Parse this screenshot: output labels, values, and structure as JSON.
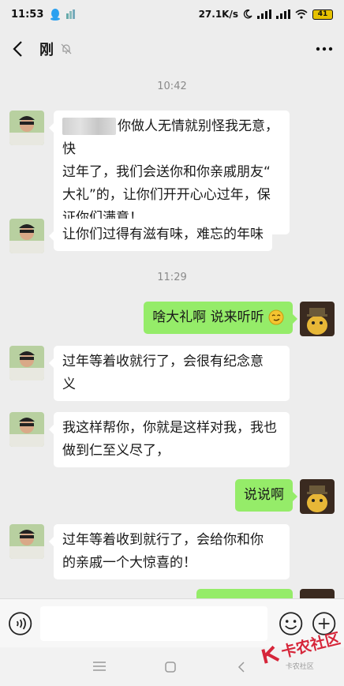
{
  "status_bar": {
    "time": "11:53",
    "net_speed": "27.1K/s",
    "battery": "41"
  },
  "header": {
    "title": "刚"
  },
  "timestamps": [
    "10:42",
    "11:29"
  ],
  "messages": [
    {
      "sender": "other",
      "text": "你做人无情就别怪我无意，快过年了，我们会送你和你亲戚朋友“大礼”的，让你们开开心心过年，保证你们满意！",
      "line1": "你做人无情就别怪我无意，快",
      "line2": "过年了，我们会送你和你亲戚朋友“",
      "line3": "大礼”的，让你们开开心心过年，保",
      "line4": "证你们满意！"
    },
    {
      "sender": "other",
      "text": "让你们过得有滋有味，难忘的年味"
    },
    {
      "sender": "me",
      "text": "啥大礼啊 说来听听"
    },
    {
      "sender": "other",
      "text": "过年等着收就行了，会很有纪念意义",
      "line1": "过年等着收就行了，会很有纪念意",
      "line2": "义"
    },
    {
      "sender": "other",
      "text": "我这样帮你，你就是这样对我，我也做到仁至义尽了，",
      "line1": "我这样帮你，你就是这样对我，我也",
      "line2": "做到仁至义尽了，"
    },
    {
      "sender": "me",
      "text": "说说啊"
    },
    {
      "sender": "other",
      "text": "过年等着收到就行了，会给你和你的亲戚一个大惊喜的！",
      "line1": "过年等着收到就行了，会给你和你",
      "line2": "的亲戚一个大惊喜的！"
    }
  ],
  "watermark": {
    "brand": "卡农社区",
    "small": "卡农社区"
  },
  "colors": {
    "background": "#ededed",
    "my_bubble": "#95ec69",
    "other_bubble": "#ffffff",
    "watermark": "#d6263a"
  }
}
